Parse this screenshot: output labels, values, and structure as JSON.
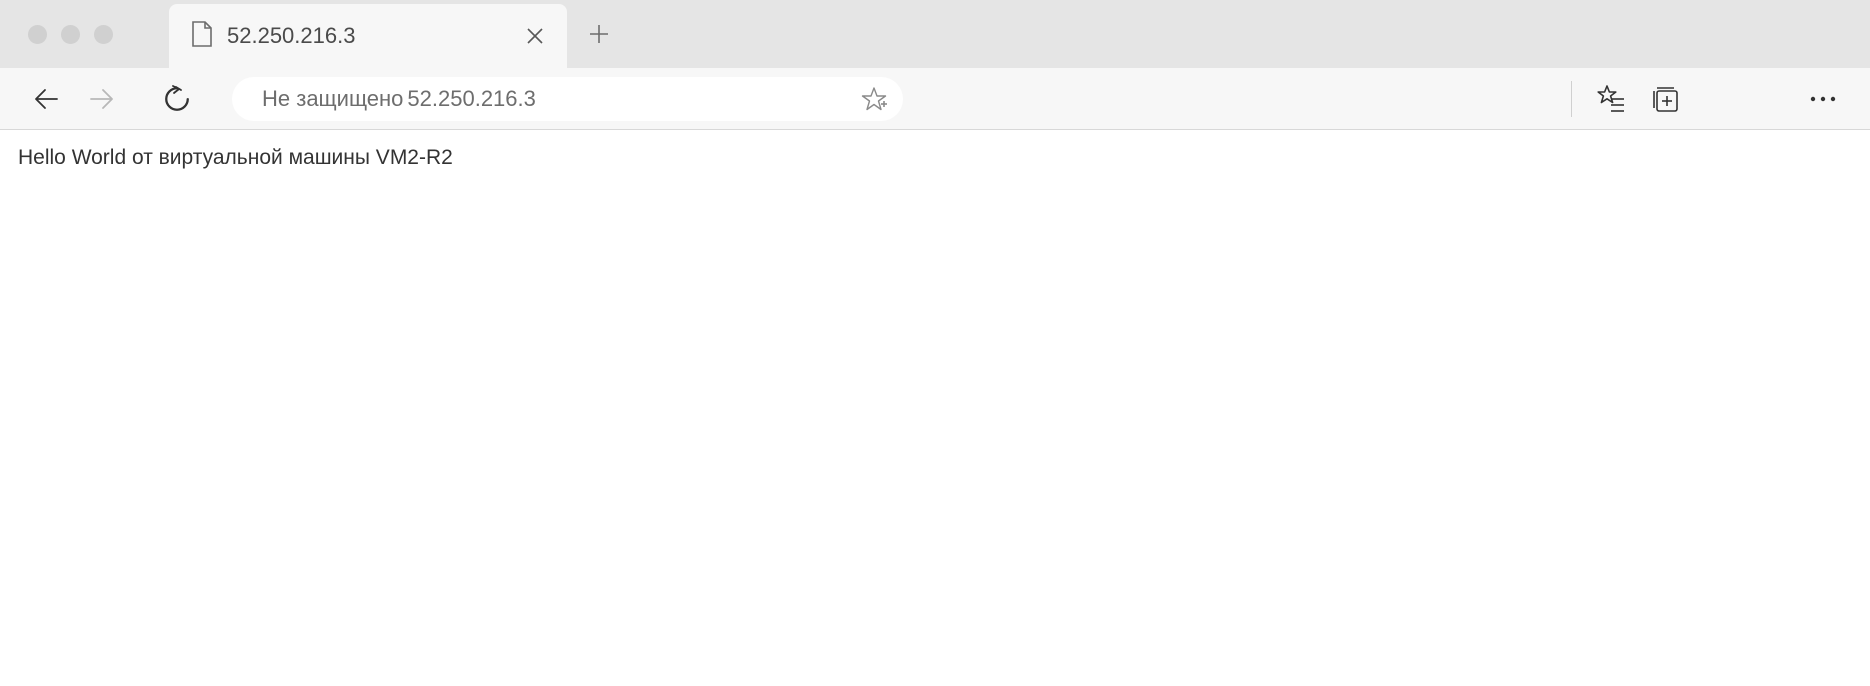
{
  "tab": {
    "title": "52.250.216.3"
  },
  "address": {
    "security_label": "Не защищено ",
    "url": "52.250.216.3"
  },
  "page": {
    "body_text": "Hello World от виртуальной машины VM2-R2"
  }
}
